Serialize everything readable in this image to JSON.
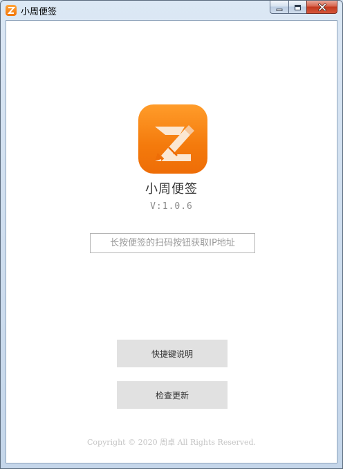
{
  "window": {
    "title": "小周便签"
  },
  "caption": {
    "minimize_icon": "minimize-icon",
    "maximize_icon": "maximize-icon",
    "close_icon": "close-icon"
  },
  "app": {
    "name": "小周便签",
    "version": "V:1.0.6",
    "logo_icon": "z-pencil-logo"
  },
  "ip_input": {
    "value": "",
    "placeholder": "长按便签的扫码按钮获取IP地址"
  },
  "buttons": {
    "shortcuts_label": "快捷键说明",
    "update_label": "检查更新"
  },
  "footer": {
    "copyright": "Copyright © 2020 周卓 All Rights Reserved."
  },
  "colors": {
    "brand_orange": "#f47a0c",
    "button_gray": "#e1e1e1",
    "close_red": "#c23a1f"
  }
}
